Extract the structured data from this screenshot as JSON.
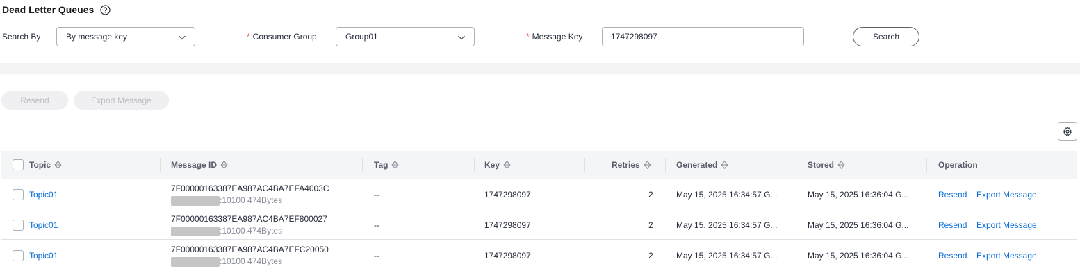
{
  "header": {
    "title": "Dead Letter Queues",
    "help_icon": "question-circle-icon"
  },
  "search": {
    "search_by_label": "Search By",
    "search_by_value": "By message key",
    "required_mark": "*",
    "consumer_group_label": "Consumer Group",
    "consumer_group_value": "Group01",
    "message_key_label": "Message Key",
    "message_key_value": "1747298097",
    "search_button": "Search"
  },
  "actions": {
    "resend": "Resend",
    "export_message": "Export Message"
  },
  "table": {
    "columns": {
      "topic": "Topic",
      "message_id": "Message ID",
      "tag": "Tag",
      "key": "Key",
      "retries": "Retries",
      "generated": "Generated",
      "stored": "Stored",
      "operation": "Operation"
    },
    "rows": [
      {
        "topic": "Topic01",
        "message_id": "7F00000163387EA987AC4BA7EFA4003C",
        "address_suffix": ":10100 474Bytes",
        "tag": "--",
        "key": "1747298097",
        "retries": "2",
        "generated": "May 15, 2025 16:34:57 G...",
        "stored": "May 15, 2025 16:36:04 G...",
        "op_resend": "Resend",
        "op_export": "Export Message"
      },
      {
        "topic": "Topic01",
        "message_id": "7F00000163387EA987AC4BA7EF800027",
        "address_suffix": ":10100 474Bytes",
        "tag": "--",
        "key": "1747298097",
        "retries": "2",
        "generated": "May 15, 2025 16:34:57 G...",
        "stored": "May 15, 2025 16:36:04 G...",
        "op_resend": "Resend",
        "op_export": "Export Message"
      },
      {
        "topic": "Topic01",
        "message_id": "7F00000163387EA987AC4BA7EFC20050",
        "address_suffix": ":10100 474Bytes",
        "tag": "--",
        "key": "1747298097",
        "retries": "2",
        "generated": "May 15, 2025 16:34:57 G...",
        "stored": "May 15, 2025 16:36:04 G...",
        "op_resend": "Resend",
        "op_export": "Export Message"
      }
    ]
  },
  "colors": {
    "link": "#0a6edb",
    "required": "#e54545",
    "header_bg": "#f4f5f6"
  }
}
